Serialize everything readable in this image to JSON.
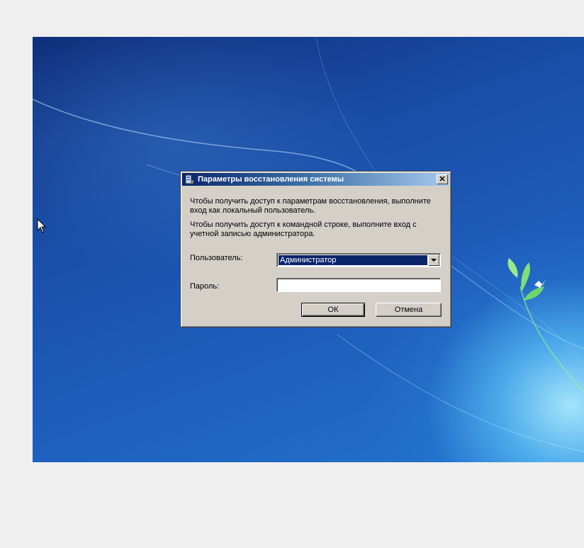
{
  "dialog": {
    "title": "Параметры восстановления системы",
    "close_glyph": "✕",
    "message_1": "Чтобы получить доступ к параметрам восстановления, выполните вход как локальный пользователь.",
    "message_2": "Чтобы получить доступ к командной строке, выполните вход с учетной записью администратора.",
    "user_label": "Пользователь:",
    "user_value": "Администратор",
    "password_label": "Пароль:",
    "password_value": "",
    "ok_label": "ОК",
    "cancel_label": "Отмена"
  },
  "icons": {
    "title_icon": "system-recovery-icon",
    "close": "close-icon",
    "dropdown": "chevron-down-icon",
    "cursor": "mouse-pointer-icon"
  },
  "colors": {
    "desktop_dark": "#0e2f7a",
    "desktop_light": "#aeeaff",
    "titlebar_start": "#0a246a",
    "titlebar_end": "#a6caf0",
    "dialog_bg": "#d4d0c8",
    "selection": "#0a246a"
  }
}
